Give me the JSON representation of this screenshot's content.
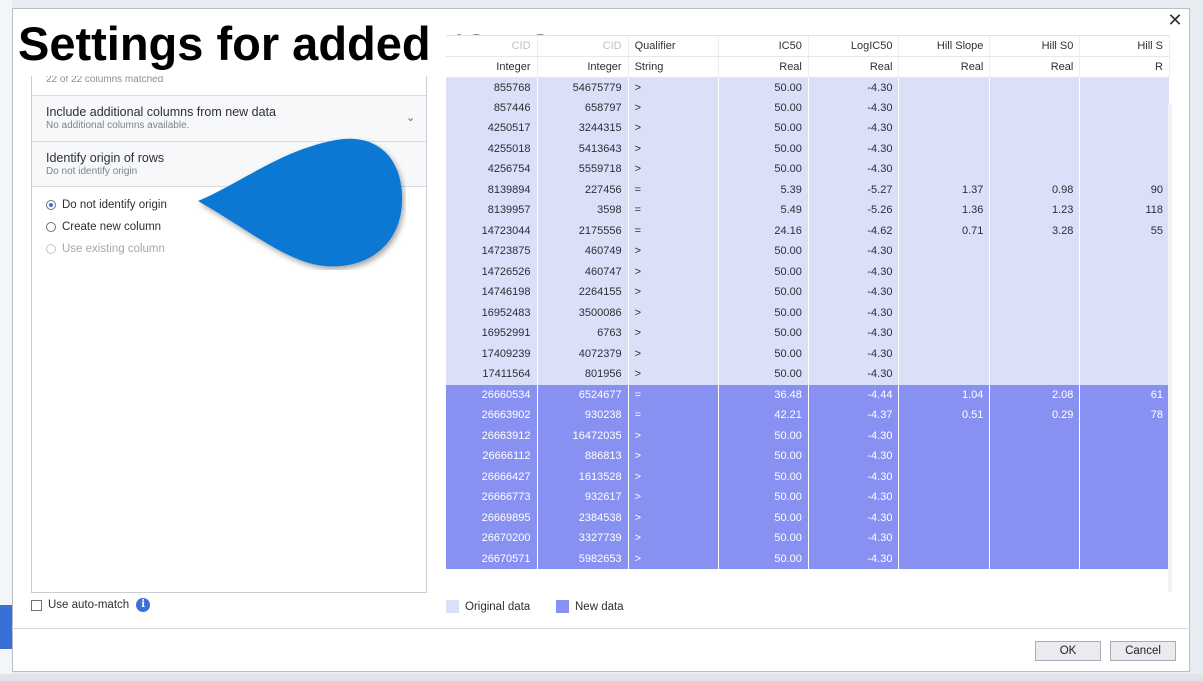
{
  "overlay_title": "Settings for added rows",
  "close_glyph": "✕",
  "left_panel": {
    "match_summary": "22 of 22 columns matched",
    "additional_columns": {
      "title": "Include additional columns from new data",
      "subtitle": "No additional columns available.",
      "chevron": "⌄"
    },
    "identify_origin": {
      "title": "Identify origin of rows",
      "subtitle": "Do not identify origin"
    },
    "radio_options": [
      {
        "label": "Do not identify origin",
        "checked": true,
        "disabled": false
      },
      {
        "label": "Create new column",
        "checked": false,
        "disabled": false
      },
      {
        "label": "Use existing column",
        "checked": false,
        "disabled": true
      }
    ],
    "auto_match_label": "Use auto-match",
    "info_glyph": "i"
  },
  "table": {
    "headers": [
      "CID",
      "CID",
      "Qualifier",
      "IC50",
      "LogIC50",
      "Hill Slope",
      "Hill S0",
      "Hill S"
    ],
    "types": [
      "Integer",
      "Integer",
      "String",
      "Real",
      "Real",
      "Real",
      "Real",
      "R"
    ],
    "rows": [
      {
        "kind": "orig",
        "cells": [
          "855768",
          "54675779",
          ">",
          "50.00",
          "-4.30",
          "",
          "",
          ""
        ]
      },
      {
        "kind": "orig",
        "cells": [
          "857446",
          "658797",
          ">",
          "50.00",
          "-4.30",
          "",
          "",
          ""
        ]
      },
      {
        "kind": "orig",
        "cells": [
          "4250517",
          "3244315",
          ">",
          "50.00",
          "-4.30",
          "",
          "",
          ""
        ]
      },
      {
        "kind": "orig",
        "cells": [
          "4255018",
          "5413643",
          ">",
          "50.00",
          "-4.30",
          "",
          "",
          ""
        ]
      },
      {
        "kind": "orig",
        "cells": [
          "4256754",
          "5559718",
          ">",
          "50.00",
          "-4.30",
          "",
          "",
          ""
        ]
      },
      {
        "kind": "orig",
        "cells": [
          "8139894",
          "227456",
          "=",
          "5.39",
          "-5.27",
          "1.37",
          "0.98",
          "90"
        ]
      },
      {
        "kind": "orig",
        "cells": [
          "8139957",
          "3598",
          "=",
          "5.49",
          "-5.26",
          "1.36",
          "1.23",
          "118"
        ]
      },
      {
        "kind": "orig",
        "cells": [
          "14723044",
          "2175556",
          "=",
          "24.16",
          "-4.62",
          "0.71",
          "3.28",
          "55"
        ]
      },
      {
        "kind": "orig",
        "cells": [
          "14723875",
          "460749",
          ">",
          "50.00",
          "-4.30",
          "",
          "",
          ""
        ]
      },
      {
        "kind": "orig",
        "cells": [
          "14726526",
          "460747",
          ">",
          "50.00",
          "-4.30",
          "",
          "",
          ""
        ]
      },
      {
        "kind": "orig",
        "cells": [
          "14746198",
          "2264155",
          ">",
          "50.00",
          "-4.30",
          "",
          "",
          ""
        ]
      },
      {
        "kind": "orig",
        "cells": [
          "16952483",
          "3500086",
          ">",
          "50.00",
          "-4.30",
          "",
          "",
          ""
        ]
      },
      {
        "kind": "orig",
        "cells": [
          "16952991",
          "6763",
          ">",
          "50.00",
          "-4.30",
          "",
          "",
          ""
        ]
      },
      {
        "kind": "orig",
        "cells": [
          "17409239",
          "4072379",
          ">",
          "50.00",
          "-4.30",
          "",
          "",
          ""
        ]
      },
      {
        "kind": "orig",
        "cells": [
          "17411564",
          "801956",
          ">",
          "50.00",
          "-4.30",
          "",
          "",
          ""
        ]
      },
      {
        "kind": "new",
        "cells": [
          "26660534",
          "6524677",
          "=",
          "36.48",
          "-4.44",
          "1.04",
          "2.08",
          "61"
        ]
      },
      {
        "kind": "new",
        "cells": [
          "26663902",
          "930238",
          "=",
          "42.21",
          "-4.37",
          "0.51",
          "0.29",
          "78"
        ]
      },
      {
        "kind": "new",
        "cells": [
          "26663912",
          "16472035",
          ">",
          "50.00",
          "-4.30",
          "",
          "",
          ""
        ]
      },
      {
        "kind": "new",
        "cells": [
          "26666112",
          "886813",
          ">",
          "50.00",
          "-4.30",
          "",
          "",
          ""
        ]
      },
      {
        "kind": "new",
        "cells": [
          "26666427",
          "1613528",
          ">",
          "50.00",
          "-4.30",
          "",
          "",
          ""
        ]
      },
      {
        "kind": "new",
        "cells": [
          "26666773",
          "932617",
          ">",
          "50.00",
          "-4.30",
          "",
          "",
          ""
        ]
      },
      {
        "kind": "new",
        "cells": [
          "26669895",
          "2384538",
          ">",
          "50.00",
          "-4.30",
          "",
          "",
          ""
        ]
      },
      {
        "kind": "new",
        "cells": [
          "26670200",
          "3327739",
          ">",
          "50.00",
          "-4.30",
          "",
          "",
          ""
        ]
      },
      {
        "kind": "new",
        "cells": [
          "26670571",
          "5982653",
          ">",
          "50.00",
          "-4.30",
          "",
          "",
          ""
        ]
      }
    ]
  },
  "legend": {
    "original_label": "Original data",
    "new_label": "New data",
    "original_color": "#dcdff8",
    "new_color": "#8891f1"
  },
  "buttons": {
    "ok": "OK",
    "cancel": "Cancel"
  },
  "colors": {
    "accent": "#3d6fd8",
    "callout": "#0a78d4"
  }
}
